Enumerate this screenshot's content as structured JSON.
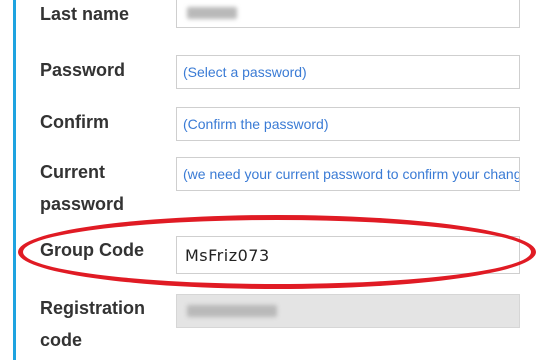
{
  "form": {
    "last_name": {
      "label": "Last name"
    },
    "password": {
      "label": "Password",
      "placeholder": "(Select a password)"
    },
    "confirm": {
      "label": "Confirm",
      "placeholder": "(Confirm the password)"
    },
    "current_password": {
      "label_line1": "Current",
      "label_line2": "password",
      "placeholder": "(we need your current password to confirm your changes)"
    },
    "group_code": {
      "label": "Group Code",
      "value": "MsFriz073"
    },
    "registration_code": {
      "label_line1": "Registration",
      "label_line2": "code"
    }
  },
  "highlight": {
    "color": "#e01b24"
  },
  "accent_color": "#1ea3e0"
}
